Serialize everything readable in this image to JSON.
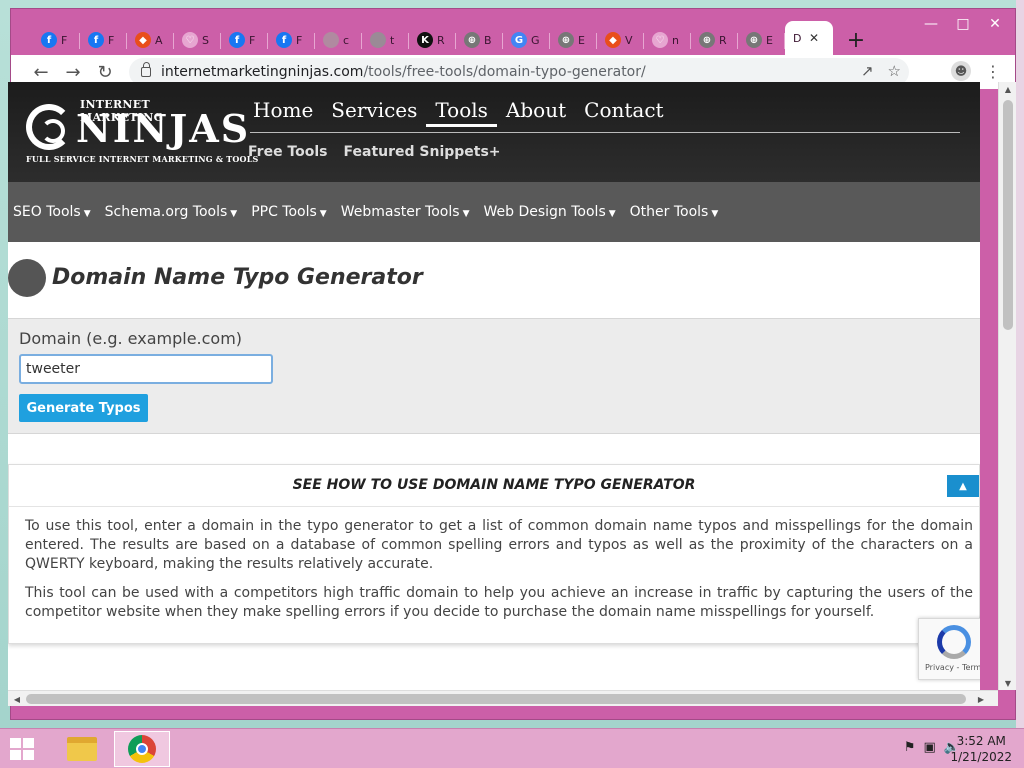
{
  "browser": {
    "tabs": [
      {
        "label": "F",
        "fav_color": "#1877f2",
        "fav_glyph": "f"
      },
      {
        "label": "F",
        "fav_color": "#1877f2",
        "fav_glyph": "f"
      },
      {
        "label": "A",
        "fav_color": "#e94e1b",
        "fav_glyph": "◆"
      },
      {
        "label": "S",
        "fav_color": "#e7a6d1",
        "fav_glyph": "♡"
      },
      {
        "label": "F",
        "fav_color": "#1877f2",
        "fav_glyph": "f"
      },
      {
        "label": "F",
        "fav_color": "#1877f2",
        "fav_glyph": "f"
      },
      {
        "label": "c",
        "fav_color": "#b08aa0",
        "fav_glyph": ""
      },
      {
        "label": "t",
        "fav_color": "#9a8a96",
        "fav_glyph": ""
      },
      {
        "label": "R",
        "fav_color": "#111111",
        "fav_glyph": "K"
      },
      {
        "label": "B",
        "fav_color": "#777777",
        "fav_glyph": "⊕"
      },
      {
        "label": "G",
        "fav_color": "#4285f4",
        "fav_glyph": "G"
      },
      {
        "label": "E",
        "fav_color": "#777777",
        "fav_glyph": "⊕"
      },
      {
        "label": "V",
        "fav_color": "#e94e1b",
        "fav_glyph": "◆"
      },
      {
        "label": "n",
        "fav_color": "#e7a6d1",
        "fav_glyph": "♡"
      },
      {
        "label": "R",
        "fav_color": "#777777",
        "fav_glyph": "⊕"
      },
      {
        "label": "E",
        "fav_color": "#777777",
        "fav_glyph": "⊕"
      }
    ],
    "active_tab": {
      "label": "D"
    },
    "url_host": "internetmarketingninjas.com",
    "url_path": "/tools/free-tools/domain-typo-generator/"
  },
  "site": {
    "logo": {
      "top": "INTERNET MARKETING",
      "main": "NINJAS",
      "sub": "FULL SERVICE INTERNET MARKETING & TOOLS"
    },
    "main_nav": [
      "Home",
      "Services",
      "Tools",
      "About",
      "Contact"
    ],
    "main_nav_active": "Tools",
    "sub_nav": [
      "Free Tools",
      "Featured Snippets+"
    ],
    "tools_nav": [
      "SEO Tools",
      "Schema.org Tools",
      "PPC Tools",
      "Webmaster Tools",
      "Web Design Tools",
      "Other Tools"
    ]
  },
  "page": {
    "title": "Domain Name Typo Generator",
    "form": {
      "label": "Domain (e.g. example.com)",
      "input_value": "tweeter",
      "button_label": "Generate Typos"
    },
    "howto": {
      "title": "SEE HOW TO USE DOMAIN NAME TYPO GENERATOR",
      "toggle_icon": "▲",
      "paragraphs": [
        "To use this tool, enter a domain in the typo generator to get a list of common domain name typos and misspellings for the domain entered. The results are based on a database of common spelling errors and typos as well as the proximity of the characters on a QWERTY keyboard, making the results relatively accurate.",
        "This tool can be used with a competitors high traffic domain to help you achieve an increase in traffic by capturing the users of the competitor website when they make spelling errors if you decide to purchase the domain name misspellings for yourself."
      ]
    },
    "recaptcha": "Privacy - Terms"
  },
  "taskbar": {
    "time": "3:52 AM",
    "date": "1/21/2022"
  },
  "colors": {
    "window_frame": "#cc5fa8",
    "accent_button": "#1fa0df",
    "tools_bar": "#595959"
  }
}
